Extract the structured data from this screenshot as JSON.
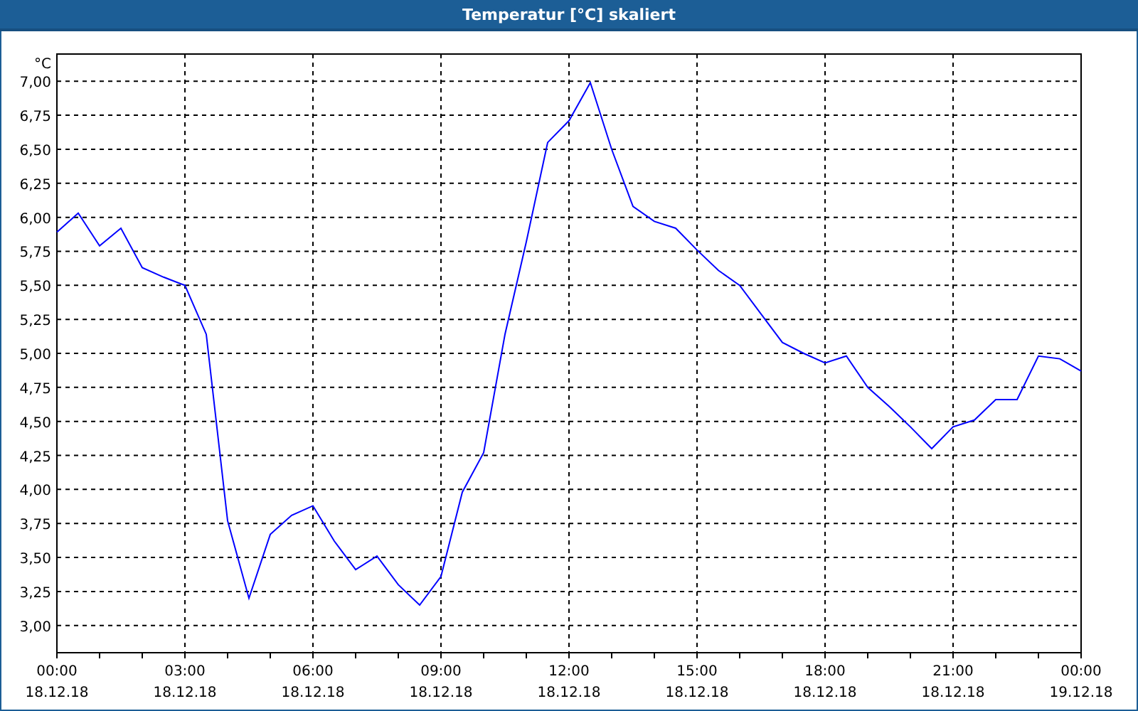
{
  "window": {
    "title": "Temperatur [°C] skaliert"
  },
  "chart": {
    "chart_data": {
      "type": "line",
      "ylabel": "°C",
      "grid": true,
      "categories": [
        "00:00 18.12.18",
        null,
        null,
        null,
        null,
        null,
        "03:00 18.12.18",
        null,
        null,
        null,
        null,
        null,
        "06:00 18.12.18",
        null,
        null,
        null,
        null,
        null,
        "09:00 18.12.18",
        null,
        null,
        null,
        null,
        null,
        "12:00 18.12.18",
        null,
        null,
        null,
        null,
        null,
        "15:00 18.12.18",
        null,
        null,
        null,
        null,
        null,
        "18:00 18.12.18",
        null,
        null,
        null,
        null,
        null,
        "21:00 18.12.18",
        null,
        null,
        null,
        null,
        null,
        "00:00 19.12.18"
      ],
      "series": [
        {
          "color": "#0000ff",
          "values": [
            5.89,
            6.03,
            5.79,
            5.92,
            5.63,
            5.56,
            5.5,
            5.14,
            3.77,
            3.2,
            3.67,
            3.81,
            3.88,
            3.62,
            3.41,
            3.51,
            3.3,
            3.15,
            3.36,
            3.98,
            4.27,
            5.14,
            5.82,
            6.55,
            6.71,
            6.99,
            6.5,
            6.08,
            5.97,
            5.92,
            5.76,
            5.61,
            5.5,
            5.29,
            5.08,
            5.0,
            4.93,
            4.98,
            4.75,
            4.61,
            4.46,
            4.3,
            4.46,
            4.51,
            4.66,
            4.66,
            4.98,
            4.96,
            4.87
          ]
        }
      ],
      "ylim": [
        2.8,
        7.2
      ],
      "yticks": [
        {
          "value": 3,
          "label": "3,00"
        },
        {
          "value": 3.25,
          "label": "3,25"
        },
        {
          "value": 3.5,
          "label": "3,50"
        },
        {
          "value": 3.75,
          "label": "3,75"
        },
        {
          "value": 4,
          "label": "4,00"
        },
        {
          "value": 4.25,
          "label": "4,25"
        },
        {
          "value": 4.5,
          "label": "4,50"
        },
        {
          "value": 4.75,
          "label": "4,75"
        },
        {
          "value": 5,
          "label": "5,00"
        },
        {
          "value": 5.25,
          "label": "5,25"
        },
        {
          "value": 5.5,
          "label": "5,50"
        },
        {
          "value": 5.75,
          "label": "5,75"
        },
        {
          "value": 6,
          "label": "6,00"
        },
        {
          "value": 6.25,
          "label": "6,25"
        },
        {
          "value": 6.5,
          "label": "6,50"
        },
        {
          "value": 6.75,
          "label": "6,75"
        },
        {
          "value": 7,
          "label": "7,00"
        }
      ]
    }
  }
}
